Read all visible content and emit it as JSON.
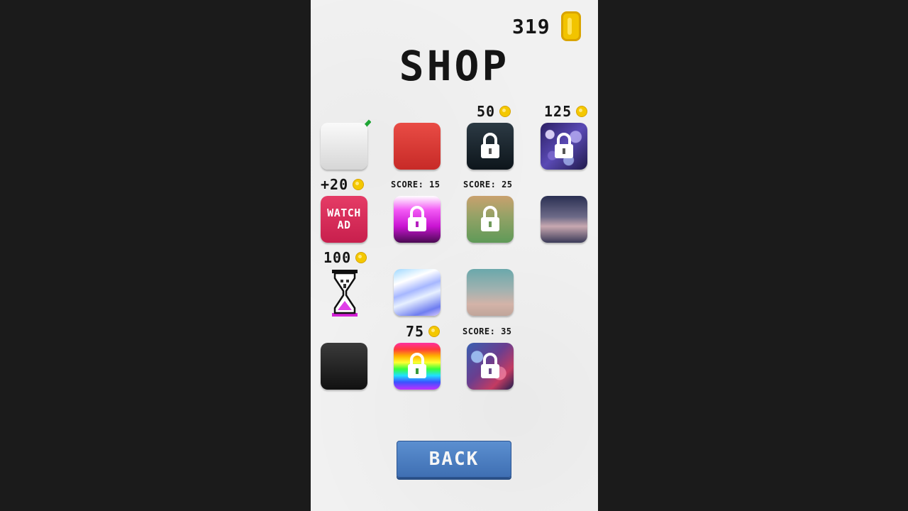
{
  "header": {
    "coins": "319",
    "title": "SHOP"
  },
  "labels": {
    "price_dark": "50",
    "price_bokeh": "125",
    "watch_reward": "+20",
    "score_magenta": "SCORE: 15",
    "score_olive": "SCORE: 25",
    "price_hourglass": "100",
    "price_rainbow": "75",
    "score_galaxy": "SCORE: 35"
  },
  "watch_ad": {
    "line1": "WATCH",
    "line2": "AD"
  },
  "back_button": "BACK",
  "colors": {
    "coin": "#f2c400",
    "back_button": "#4a7fc2",
    "check": "#1ea534"
  },
  "skins": [
    {
      "name": "white",
      "state": "selected"
    },
    {
      "name": "red",
      "state": "owned"
    },
    {
      "name": "dark",
      "state": "locked"
    },
    {
      "name": "bokeh",
      "state": "locked"
    },
    {
      "name": "watch-ad",
      "state": "action"
    },
    {
      "name": "magenta",
      "state": "locked"
    },
    {
      "name": "olive",
      "state": "locked"
    },
    {
      "name": "night-sky",
      "state": "owned"
    },
    {
      "name": "hourglass",
      "state": "for-sale"
    },
    {
      "name": "stripes",
      "state": "owned"
    },
    {
      "name": "dusk",
      "state": "owned"
    },
    {
      "name": "black",
      "state": "owned"
    },
    {
      "name": "rainbow",
      "state": "locked"
    },
    {
      "name": "galaxy",
      "state": "locked"
    }
  ]
}
